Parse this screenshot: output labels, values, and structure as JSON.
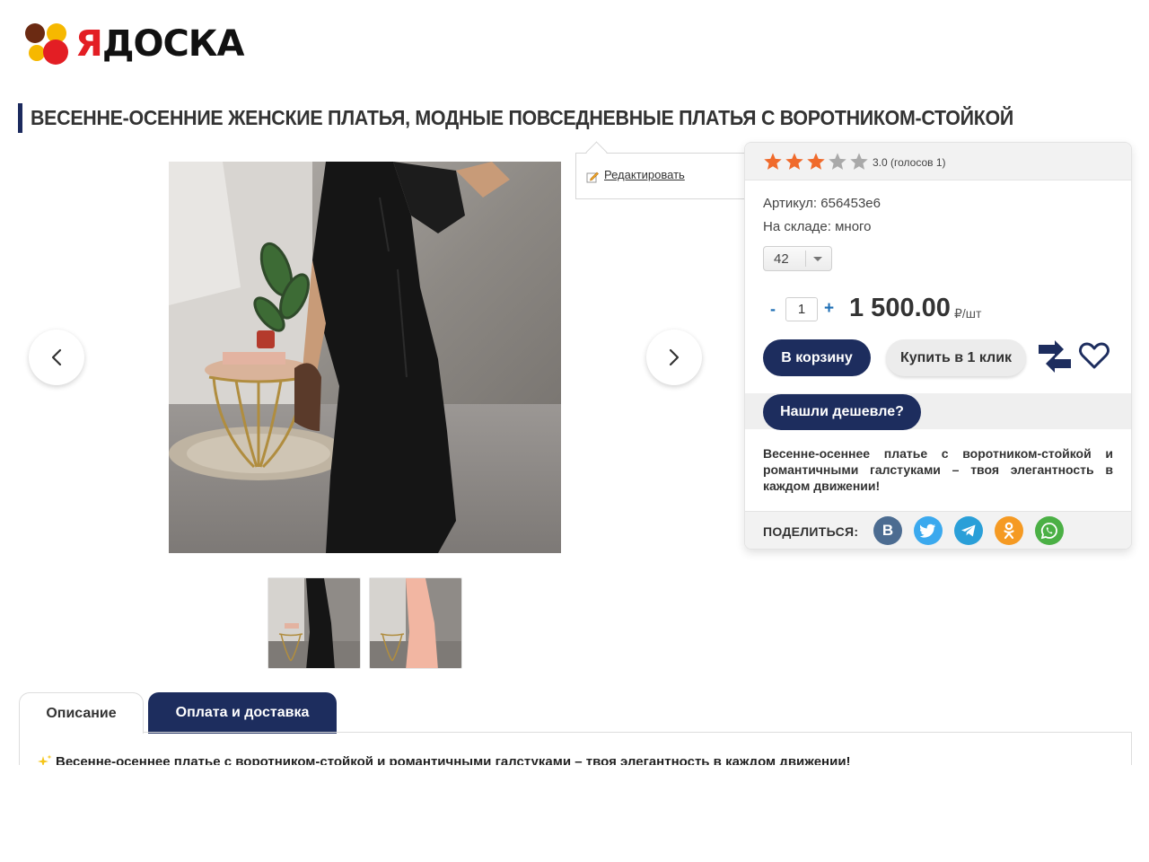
{
  "logo": {
    "first_letter": "Я",
    "rest": "ДОСКА"
  },
  "product": {
    "title": "ВЕСЕННЕ-ОСЕННИЕ ЖЕНСКИЕ ПЛАТЬЯ, МОДНЫЕ ПОВСЕДНЕВНЫЕ ПЛАТЬЯ С ВОРОТНИКОМ-СТОЙКОЙ",
    "rating": {
      "value": 3.0,
      "max": 5,
      "text": "3.0 (голосов 1)"
    },
    "sku": "Артикул: 656453е6",
    "stock": "На складе: много",
    "size": {
      "selected": "42"
    },
    "quantity": "1",
    "qty_minus": "-",
    "qty_plus": "+",
    "price": "1 500.00",
    "price_unit": "₽/шт",
    "short_description": "Весенне-осеннее платье с воротником-стойкой и романтичными галстуками – твоя элегантность в каждом движении!"
  },
  "edit_popup": {
    "label": "Редактировать"
  },
  "buttons": {
    "cart": "В корзину",
    "one_click": "Купить в 1 клик",
    "cheaper": "Нашли дешевле?"
  },
  "share": {
    "label": "ПОДЕЛИТЬСЯ:",
    "networks": [
      {
        "name": "vk",
        "letter": "B",
        "color": "#4c6c91"
      },
      {
        "name": "twitter",
        "color": "#3ba9ee"
      },
      {
        "name": "telegram",
        "color": "#2a9fd8"
      },
      {
        "name": "odnoklassniki",
        "color": "#f59a23"
      },
      {
        "name": "whatsapp",
        "color": "#4bb045"
      }
    ]
  },
  "gallery": {
    "prev_icon": "chevron-left-icon",
    "next_icon": "chevron-right-icon",
    "thumbnails": [
      "black-dress",
      "pink-dress"
    ]
  },
  "tabs": [
    {
      "label": "Описание",
      "active": true
    },
    {
      "label": "Оплата и доставка",
      "active": false
    }
  ],
  "description": {
    "first_line": "Весенне-осеннее платье с воротником-стойкой и романтичными галстуками – твоя элегантность в каждом движении!"
  },
  "colors": {
    "brand_navy": "#1d2d5e",
    "star_active": "#f06a2b",
    "star_inactive": "#a9a9a9",
    "logo_red": "#e31e24"
  }
}
